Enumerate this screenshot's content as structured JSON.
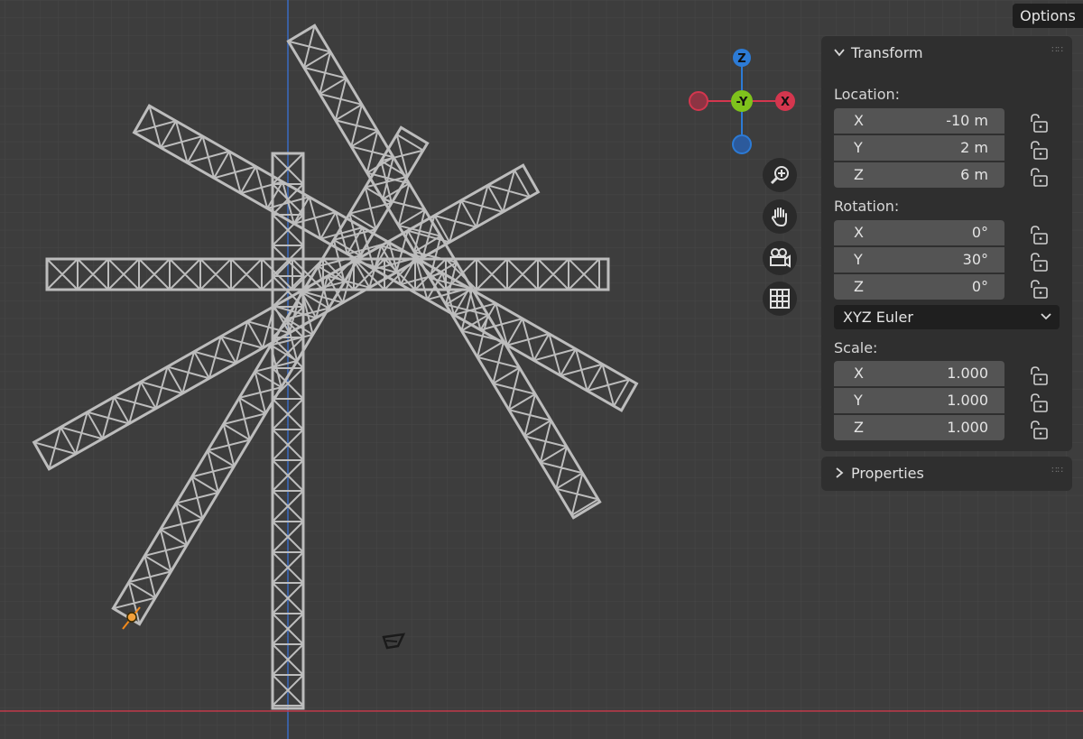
{
  "header": {
    "options_label": "Options"
  },
  "gizmo": {
    "z_label": "Z",
    "neg_y_label": "-Y",
    "x_label": "X",
    "colors": {
      "z": "#2c7bd6",
      "y": "#7fc31c",
      "x": "#d4364e"
    }
  },
  "nav_icons": [
    "zoom-icon",
    "hand-pan-icon",
    "camera-icon",
    "grid-ortho-icon"
  ],
  "transform_panel": {
    "title": "Transform",
    "location": {
      "label": "Location:",
      "x": {
        "axis": "X",
        "value": "-10 m"
      },
      "y": {
        "axis": "Y",
        "value": "2 m"
      },
      "z": {
        "axis": "Z",
        "value": "6 m"
      }
    },
    "rotation": {
      "label": "Rotation:",
      "x": {
        "axis": "X",
        "value": "0°"
      },
      "y": {
        "axis": "Y",
        "value": "30°"
      },
      "z": {
        "axis": "Z",
        "value": "0°"
      }
    },
    "rotation_mode": "XYZ Euler",
    "scale": {
      "label": "Scale:",
      "x": {
        "axis": "X",
        "value": "1.000"
      },
      "y": {
        "axis": "Y",
        "value": "1.000"
      },
      "z": {
        "axis": "Z",
        "value": "1.000"
      }
    }
  },
  "properties_panel": {
    "title": "Properties"
  },
  "scene": {
    "background": "#3d3d3d",
    "grid_color": "#4a4a4a",
    "truss_color": "#bdbdbd",
    "axis_blue": "#3a6bc2",
    "axis_red": "#c23a4a"
  }
}
